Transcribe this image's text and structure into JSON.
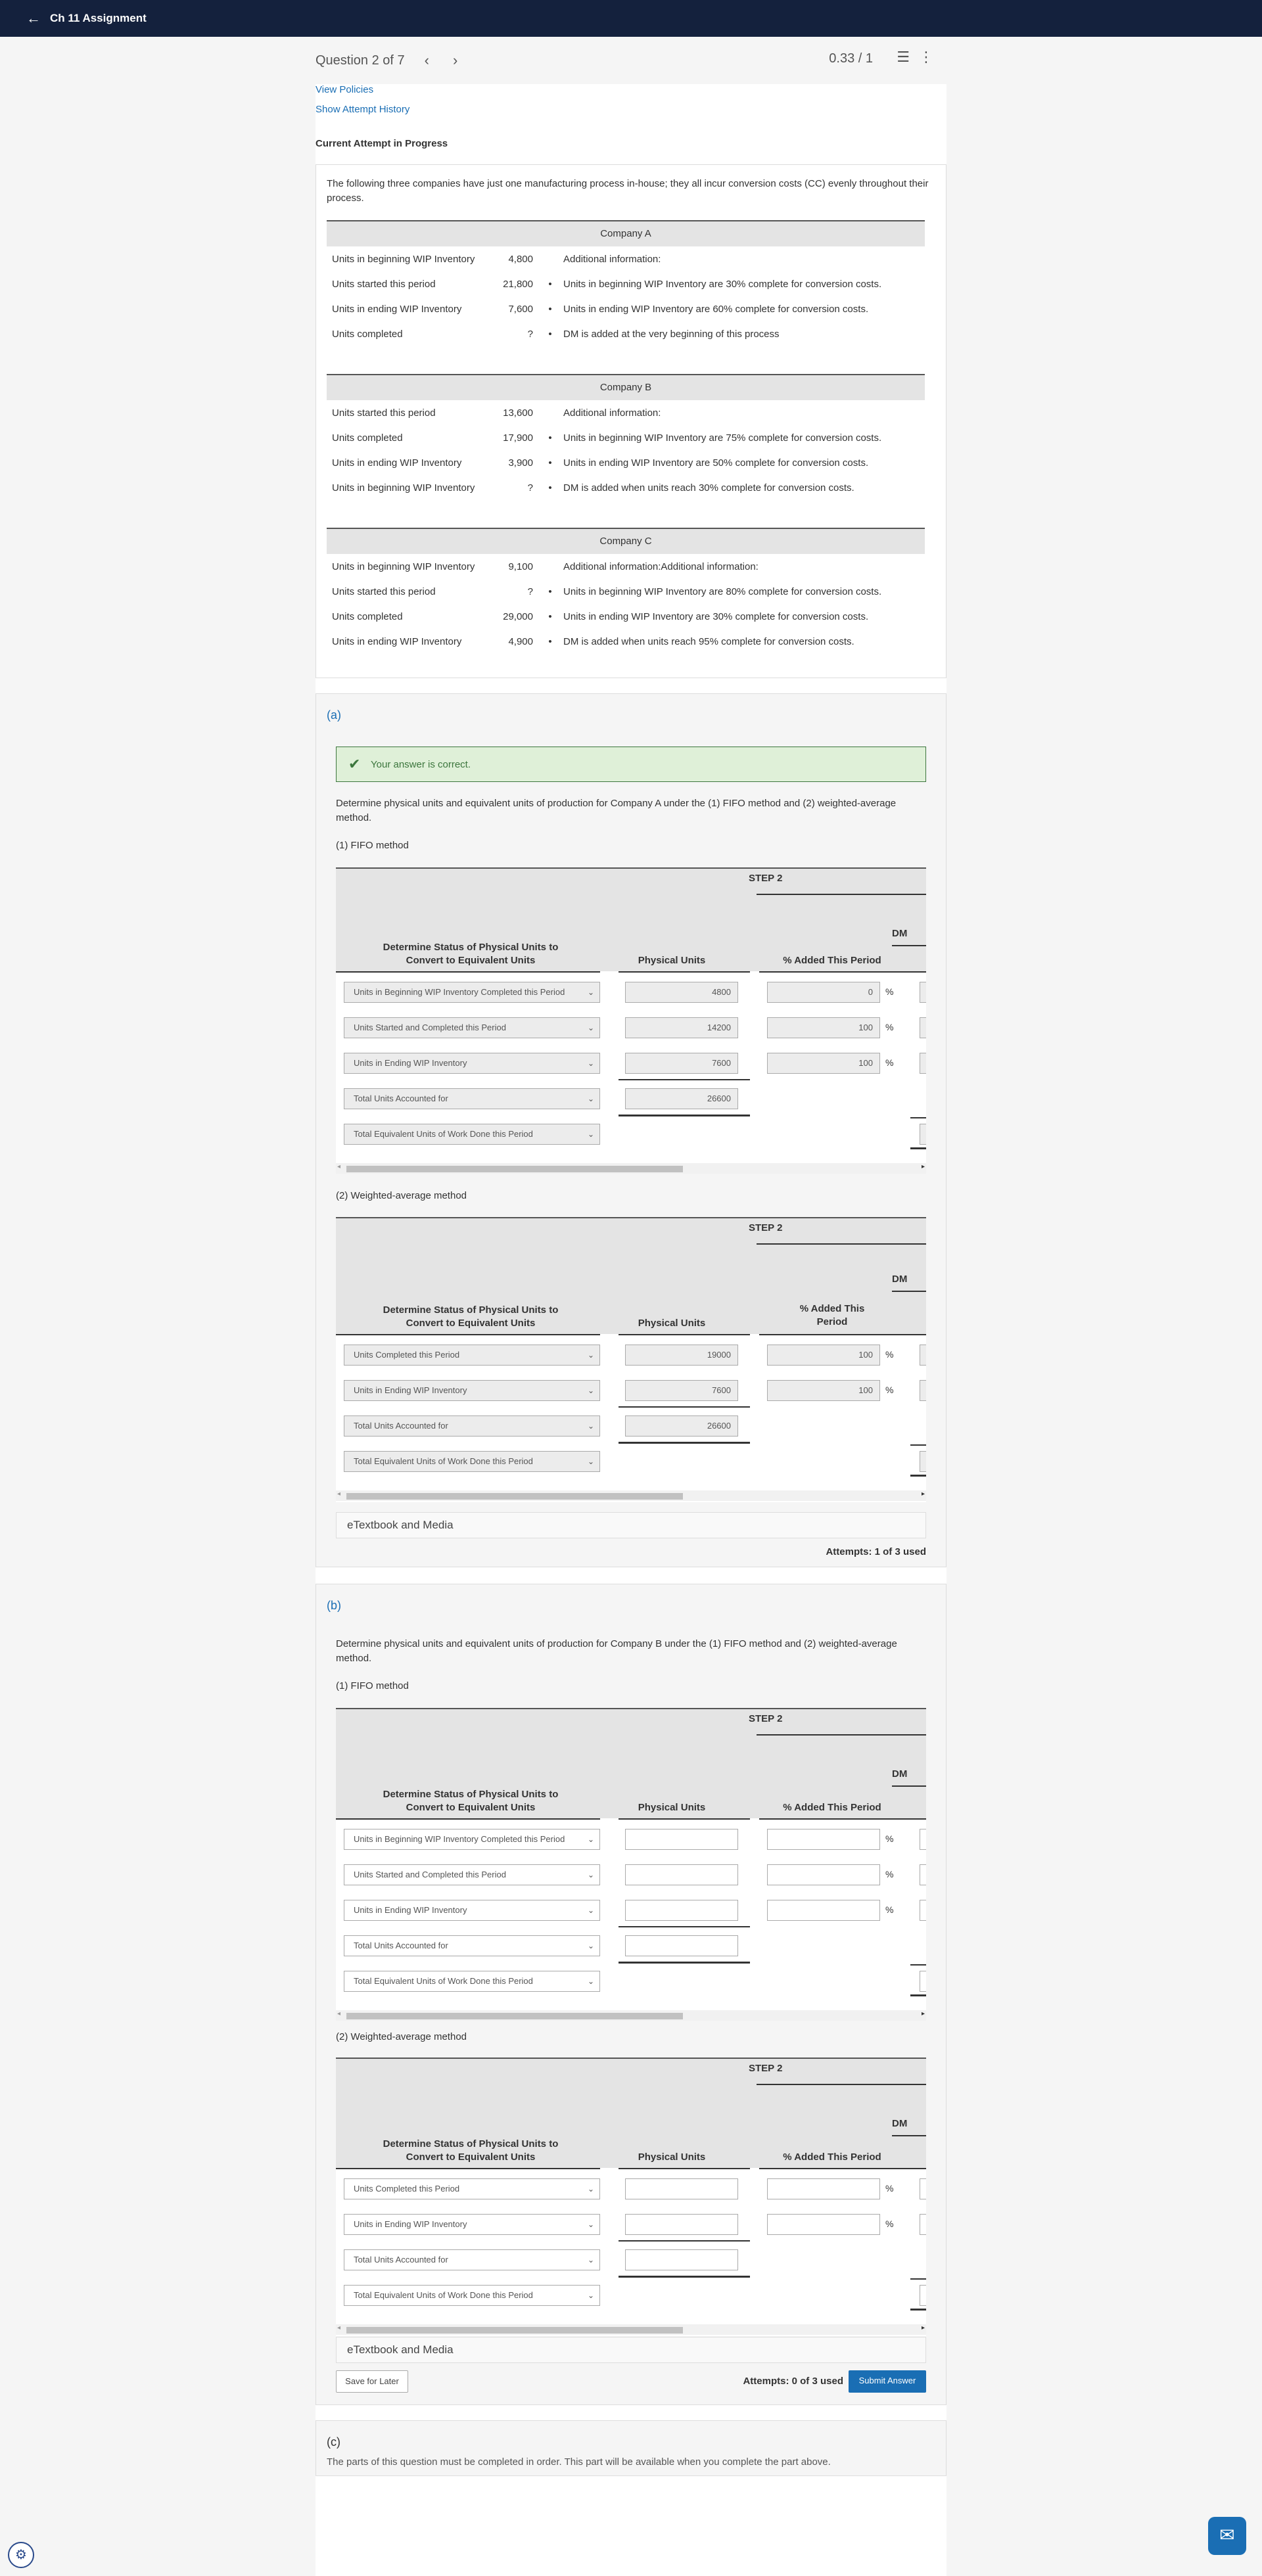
{
  "topbar": {
    "back_icon": "arrow-left-icon",
    "title": "Ch 11 Assignment"
  },
  "question": {
    "title": "Question 2 of 7",
    "score": "0.33 / 1",
    "view_policies": "View Policies",
    "show_history": "Show Attempt History",
    "current_attempt": "Current Attempt in Progress"
  },
  "intro": {
    "text": "The following three companies have just one manufacturing process in-house; they all incur conversion costs (CC) evenly throughout their process.",
    "companies": [
      {
        "name": "Company A",
        "rows": [
          {
            "label": "Units in beginning WIP Inventory",
            "value": "4,800",
            "bullet": "",
            "info": "Additional information:"
          },
          {
            "label": "Units started this period",
            "value": "21,800",
            "bullet": "•",
            "info": "Units in beginning WIP Inventory are 30% complete for conversion costs."
          },
          {
            "label": "Units in ending WIP Inventory",
            "value": "7,600",
            "bullet": "•",
            "info": "Units in ending WIP Inventory are 60% complete for conversion costs."
          },
          {
            "label": "Units completed",
            "value": "?",
            "bullet": "•",
            "info": "DM is added at the very beginning of this process"
          }
        ]
      },
      {
        "name": "Company B",
        "rows": [
          {
            "label": "Units started this period",
            "value": "13,600",
            "bullet": "",
            "info": "Additional information:"
          },
          {
            "label": "Units completed",
            "value": "17,900",
            "bullet": "•",
            "info": "Units in beginning WIP Inventory are 75% complete for conversion costs."
          },
          {
            "label": "Units in ending WIP Inventory",
            "value": "3,900",
            "bullet": "•",
            "info": "Units in ending WIP Inventory are 50% complete for conversion costs."
          },
          {
            "label": "Units in beginning WIP Inventory",
            "value": "?",
            "bullet": "•",
            "info": "DM is added when units reach 30% complete for conversion costs."
          }
        ]
      },
      {
        "name": "Company C",
        "rows": [
          {
            "label": "Units in beginning WIP Inventory",
            "value": "9,100",
            "bullet": "",
            "info": "Additional information:Additional information:"
          },
          {
            "label": "Units started this period",
            "value": "?",
            "bullet": "•",
            "info": "Units in beginning WIP Inventory are 80% complete for conversion costs."
          },
          {
            "label": "Units completed",
            "value": "29,000",
            "bullet": "•",
            "info": "Units in ending WIP Inventory are 30% complete for conversion costs."
          },
          {
            "label": "Units in ending WIP Inventory",
            "value": "4,900",
            "bullet": "•",
            "info": "DM is added when units reach 95% complete for conversion costs."
          }
        ]
      }
    ]
  },
  "common": {
    "step2": "STEP 2",
    "dm": "DM",
    "status_header": "Determine Status of Physical Units to Convert to Equivalent Units",
    "physical_units": "Physical Units",
    "pct_added": "% Added This Period",
    "pct_sign": "%",
    "etextbook": "eTextbook and Media",
    "fifo_label": "(1) FIFO method",
    "wa_label": "(2) Weighted-average method"
  },
  "part_a": {
    "letter": "(a)",
    "correct_msg": "Your answer is correct.",
    "instruction": "Determine physical units and equivalent units of production for Company A under the (1) FIFO method and (2) weighted-average method.",
    "fifo_rows": [
      {
        "select": "Units in Beginning WIP Inventory Completed this Period",
        "units": "4800",
        "pct": "0"
      },
      {
        "select": "Units Started and Completed this Period",
        "units": "14200",
        "pct": "100"
      },
      {
        "select": "Units in Ending WIP Inventory",
        "units": "7600",
        "pct": "100"
      },
      {
        "select": "Total Units Accounted for",
        "units": "26600"
      },
      {
        "select": "Total Equivalent Units of Work Done this Period"
      }
    ],
    "wa_pct_header": "% Added This Period",
    "wa_rows": [
      {
        "select": "Units Completed this Period",
        "units": "19000",
        "pct": "100"
      },
      {
        "select": "Units in Ending WIP Inventory",
        "units": "7600",
        "pct": "100"
      },
      {
        "select": "Total Units Accounted for",
        "units": "26600"
      },
      {
        "select": "Total Equivalent Units of Work Done this Period"
      }
    ],
    "attempts": "Attempts: 1 of 3 used"
  },
  "part_b": {
    "letter": "(b)",
    "instruction": "Determine physical units and equivalent units of production for Company B under the (1) FIFO method and (2) weighted-average method.",
    "fifo_rows": [
      {
        "select": "Units in Beginning WIP Inventory Completed this Period"
      },
      {
        "select": "Units Started and Completed this Period"
      },
      {
        "select": "Units in Ending WIP Inventory"
      },
      {
        "select": "Total Units Accounted for"
      },
      {
        "select": "Total Equivalent Units of Work Done this Period"
      }
    ],
    "wa_rows": [
      {
        "select": "Units Completed this Period"
      },
      {
        "select": "Units in Ending WIP Inventory"
      },
      {
        "select": "Total Units Accounted for"
      },
      {
        "select": "Total Equivalent Units of Work Done this Period"
      }
    ],
    "save_label": "Save for Later",
    "attempts": "Attempts: 0 of 3 used",
    "submit_label": "Submit Answer"
  },
  "part_c": {
    "letter": "(c)",
    "text": "The parts of this question must be completed in order. This part will be available when you complete the part above."
  },
  "icons": {
    "chat": "chat-icon",
    "cookie": "cookie-settings-icon"
  }
}
